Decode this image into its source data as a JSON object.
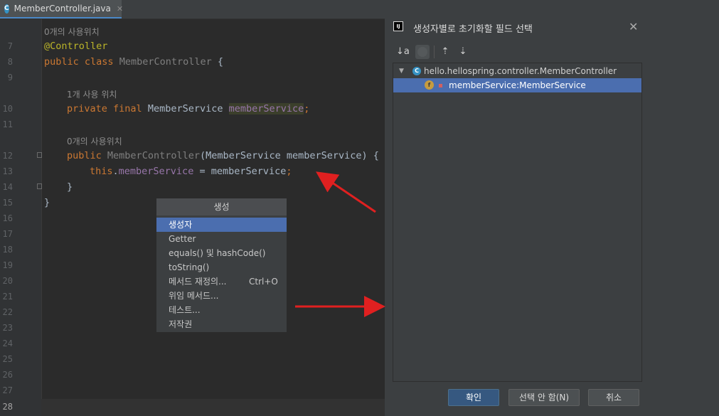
{
  "editor": {
    "tab": {
      "filename": "MemberController.java",
      "icon": "class-c-icon",
      "close": "✕"
    },
    "line_numbers": [
      "7",
      "8",
      "9",
      "10",
      "11",
      "12",
      "13",
      "14",
      "15",
      "16",
      "17",
      "18",
      "19",
      "20",
      "21",
      "22",
      "23",
      "24",
      "25",
      "26",
      "27",
      "28"
    ],
    "usage_hint_top": "0개의 사용위치",
    "usage_hint_field": "1개 사용 위치",
    "usage_hint_ctor": "0개의 사용위치",
    "code": {
      "annotation": "@Controller",
      "class_kw": "public class",
      "class_name": "MemberController",
      "brace_open": "{",
      "field_kw": "private final",
      "field_type": "MemberService",
      "field_name": "memberService",
      "semicolon": ";",
      "ctor_kw": "public",
      "ctor_name": "MemberController",
      "ctor_params": "(MemberService memberService) {",
      "this_kw": "this",
      "dot": ".",
      "assign_field": "memberService",
      "assign_rest": " = memberService",
      "close_inner": "}",
      "close_outer": "}"
    }
  },
  "generate_popup": {
    "title": "생성",
    "items": [
      {
        "label": "생성자",
        "shortcut": "",
        "selected": true
      },
      {
        "label": "Getter",
        "shortcut": ""
      },
      {
        "label": "equals() 및 hashCode()",
        "shortcut": ""
      },
      {
        "label": "toString()",
        "shortcut": ""
      },
      {
        "label": "메서드 재정의...",
        "shortcut": "Ctrl+O"
      },
      {
        "label": "위임 메서드...",
        "shortcut": ""
      },
      {
        "label": "테스트...",
        "shortcut": ""
      },
      {
        "label": "저작권",
        "shortcut": ""
      }
    ]
  },
  "dialog": {
    "title": "생성자별로 초기화할 필드 선택",
    "app_icon": "IJ",
    "close": "✕",
    "toolbar": {
      "sort_icon": "↓a",
      "expand_icon": "⇡",
      "collapse_icon": "⇣"
    },
    "tree": {
      "root": "hello.hellospring.controller.MemberController",
      "field": "memberService:MemberService"
    },
    "buttons": {
      "ok": "확인",
      "select_none": "선택 안 함(N)",
      "cancel": "취소"
    }
  },
  "colors": {
    "accent": "#4b6eaf",
    "arrow": "#e02020"
  }
}
